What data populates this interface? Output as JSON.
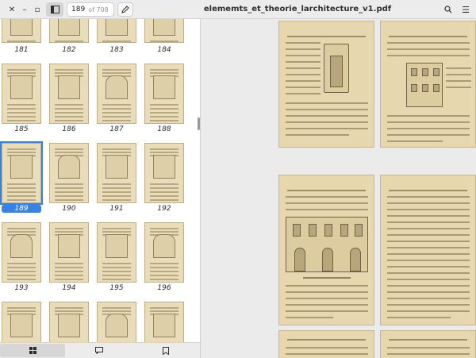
{
  "header": {
    "document_title": "elememts_et_theorie_larchitecture_v1.pdf",
    "current_page": "189",
    "total_pages": "of 708",
    "icons": {
      "close": "close-icon",
      "minimize": "minimize-icon",
      "maximize": "maximize-icon",
      "sidebar_toggle": "sidebar-icon",
      "annotate": "pencil-icon",
      "search": "search-icon",
      "menu": "hamburger-menu-icon"
    }
  },
  "sidebar": {
    "thumbnails": [
      {
        "label": "181"
      },
      {
        "label": "182"
      },
      {
        "label": "183"
      },
      {
        "label": "184"
      },
      {
        "label": "185"
      },
      {
        "label": "186"
      },
      {
        "label": "187"
      },
      {
        "label": "188"
      },
      {
        "label": "189",
        "selected": true
      },
      {
        "label": "190"
      },
      {
        "label": "191"
      },
      {
        "label": "192"
      },
      {
        "label": "193"
      },
      {
        "label": "194"
      },
      {
        "label": "195"
      },
      {
        "label": "196"
      },
      {
        "label": ""
      },
      {
        "label": ""
      },
      {
        "label": ""
      },
      {
        "label": ""
      }
    ],
    "bottom_tabs": [
      {
        "icon": "grid-thumbnails-icon",
        "active": true
      },
      {
        "icon": "annotations-icon",
        "active": false
      },
      {
        "icon": "bookmark-icon",
        "active": false
      }
    ]
  },
  "colors": {
    "accent": "#3584e4",
    "page_paper": "#e6d7ae",
    "header_bg": "#ececec",
    "view_bg": "#ebebeb"
  }
}
